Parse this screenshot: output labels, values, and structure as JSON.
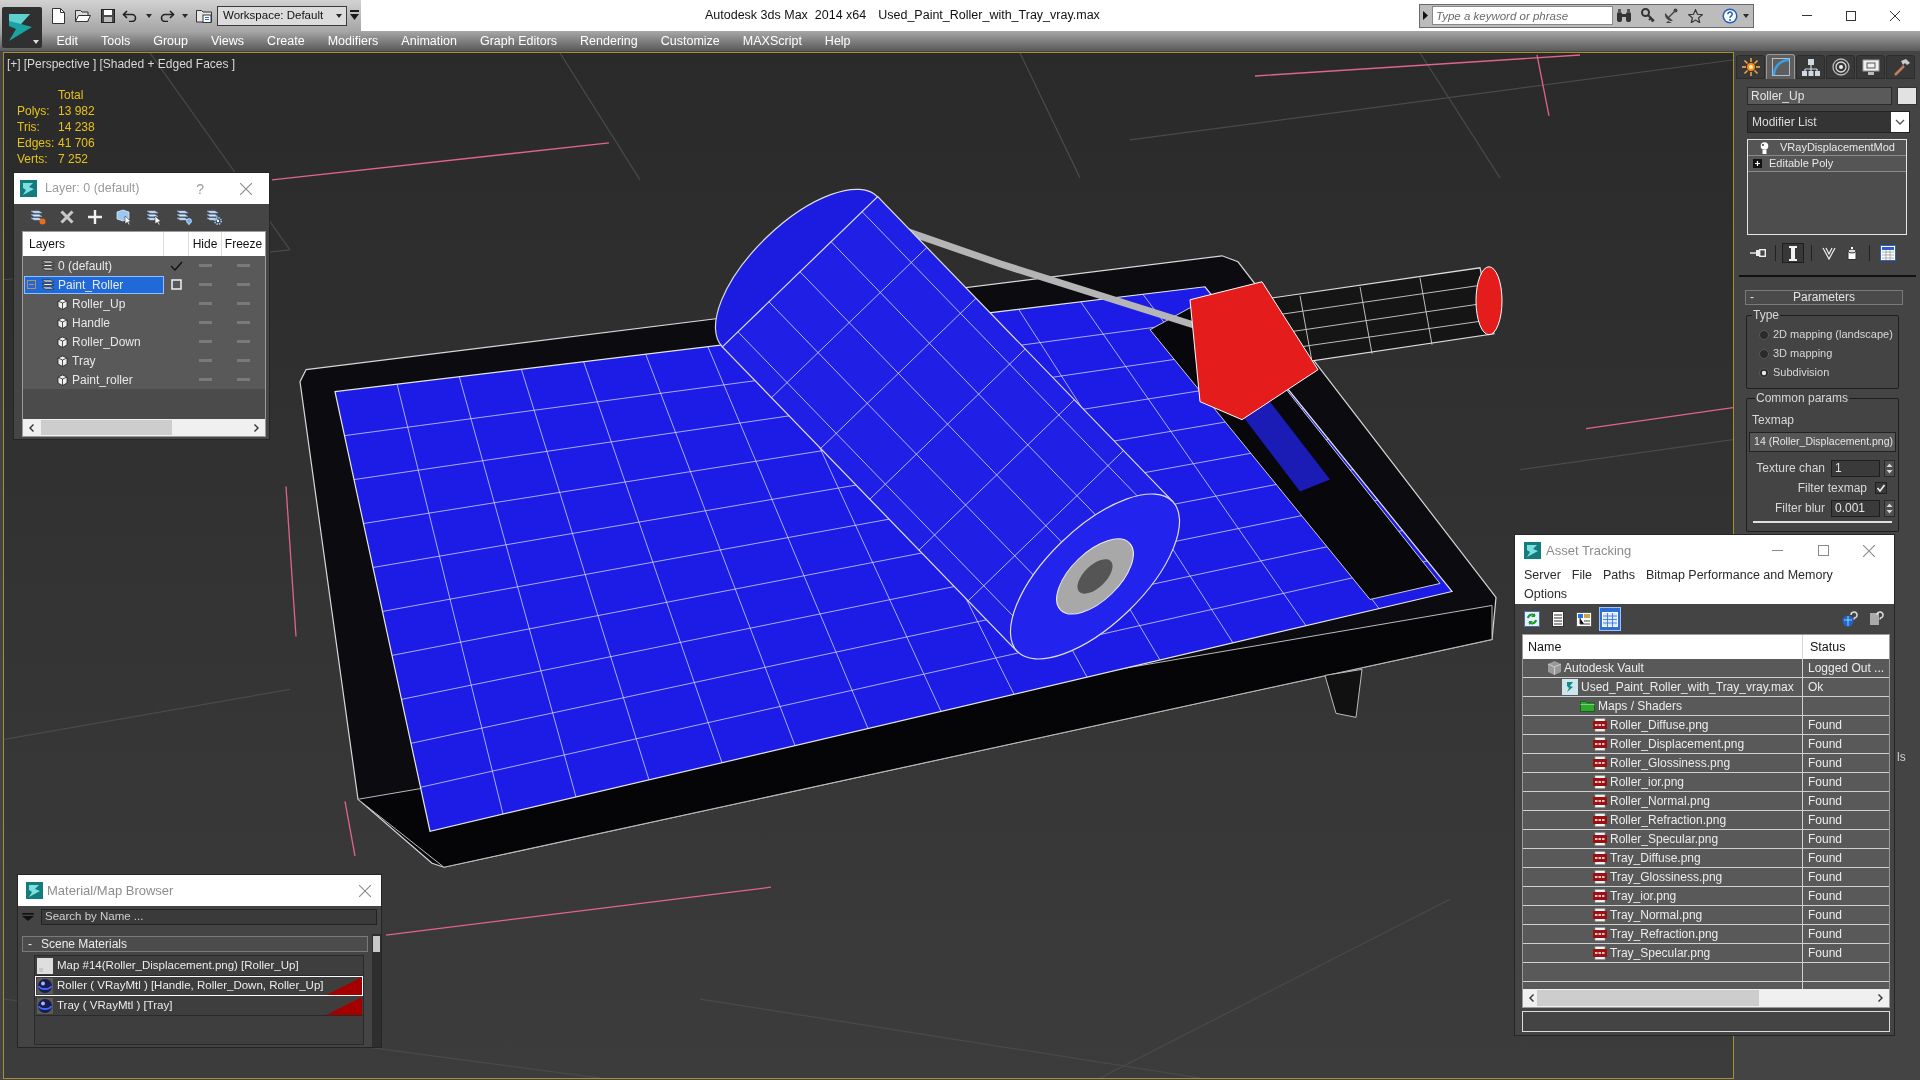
{
  "title_bar": {
    "workspace": "Workspace: Default",
    "app_title": "Autodesk 3ds Max  2014 x64",
    "file_name": "Used_Paint_Roller_with_Tray_vray.max",
    "search": {
      "placeholder": "Type a keyword or phrase"
    }
  },
  "menu_bar": [
    "Edit",
    "Tools",
    "Group",
    "Views",
    "Create",
    "Modifiers",
    "Animation",
    "Graph Editors",
    "Rendering",
    "Customize",
    "MAXScript",
    "Help"
  ],
  "viewport": {
    "labels": [
      "[+]",
      "[Perspective ]",
      "[Shaded + Edged Faces ]"
    ],
    "stats": {
      "heading": "Total",
      "rows": [
        {
          "label": "Polys:",
          "value": "13 982"
        },
        {
          "label": "Tris:",
          "value": "14 238"
        },
        {
          "label": "Edges:",
          "value": "41 706"
        },
        {
          "label": "Verts:",
          "value": "7 252"
        }
      ]
    }
  },
  "layer_dialog": {
    "title": "Layer: 0 (default)",
    "help_button": "?",
    "columns": [
      "Layers",
      "Hide",
      "Freeze"
    ],
    "layers": [
      {
        "name": "0 (default)",
        "selected": false,
        "current": true,
        "hidden": false,
        "frozen": false
      },
      {
        "name": "Paint_Roller",
        "selected": true,
        "current": false,
        "hidden": false,
        "frozen": false,
        "expanded": true,
        "children": [
          {
            "name": "Roller_Up",
            "selected": false,
            "hidden": false,
            "frozen": false
          },
          {
            "name": "Handle",
            "selected": false,
            "hidden": false,
            "frozen": false
          },
          {
            "name": "Roller_Down",
            "selected": false,
            "hidden": false,
            "frozen": false
          },
          {
            "name": "Tray",
            "selected": false,
            "hidden": false,
            "frozen": false
          },
          {
            "name": "Paint_roller",
            "selected": false,
            "hidden": false,
            "frozen": false
          }
        ]
      }
    ]
  },
  "command_panel": {
    "tabs": [
      {
        "selected": false
      },
      {
        "selected": true
      },
      {
        "selected": false
      },
      {
        "selected": false
      },
      {
        "selected": false
      },
      {
        "selected": false
      }
    ],
    "object_name": "Roller_Up",
    "modifier_list": "Modifier List",
    "modifier_stack": [
      {
        "kind": "modifier",
        "name": "VRayDisplacementMod",
        "selected": false
      },
      {
        "kind": "base_object",
        "name": "Editable Poly",
        "selected": false,
        "expanded": false
      }
    ],
    "stack_buttons": [
      {
        "pressed": false
      },
      {
        "pressed": true
      },
      {
        "pressed": false
      },
      {
        "pressed": false
      },
      {
        "pressed": false
      }
    ],
    "rollout": {
      "toggle": "-",
      "title": "Parameters",
      "type_group": {
        "label": "Type",
        "options": [
          {
            "label": "2D mapping (landscape)",
            "selected": false
          },
          {
            "label": "3D mapping",
            "selected": false
          },
          {
            "label": "Subdivision",
            "selected": true
          }
        ]
      },
      "common_group": {
        "label": "Common params",
        "texmap_label": "Texmap",
        "texmap_value": "14 (Roller_Displacement.png)",
        "fields": [
          {
            "kind": "spinner",
            "label": "Texture chan",
            "value": "1"
          },
          {
            "kind": "checkbox",
            "label": "Filter texmap",
            "checked": true
          },
          {
            "kind": "spinner",
            "label": "Filter blur",
            "value": "0.001"
          }
        ]
      }
    },
    "partial_label": "ls"
  },
  "asset_tracking": {
    "title": "Asset Tracking",
    "menu": [
      "Server",
      "File",
      "Paths",
      "Bitmap Performance and Memory",
      "Options"
    ],
    "toolbar": [
      {
        "selected": false
      },
      {
        "selected": false
      },
      {
        "selected": false
      },
      {
        "selected": true
      }
    ],
    "columns": [
      "Name",
      "Status"
    ],
    "assets": [
      {
        "kind": "vault",
        "name": "Autodesk Vault",
        "status": "Logged Out ...",
        "selected": false,
        "children": [
          {
            "kind": "scene",
            "name": "Used_Paint_Roller_with_Tray_vray.max",
            "status": "Ok",
            "selected": false,
            "children": [
              {
                "kind": "folder",
                "name": "Maps / Shaders",
                "selected": false,
                "children": [
                  {
                    "kind": "bitmap",
                    "name": "Roller_Diffuse.png",
                    "status": "Found",
                    "selected": false
                  },
                  {
                    "kind": "bitmap",
                    "name": "Roller_Displacement.png",
                    "status": "Found",
                    "selected": false
                  },
                  {
                    "kind": "bitmap",
                    "name": "Roller_Glossiness.png",
                    "status": "Found",
                    "selected": false
                  },
                  {
                    "kind": "bitmap",
                    "name": "Roller_ior.png",
                    "status": "Found",
                    "selected": false
                  },
                  {
                    "kind": "bitmap",
                    "name": "Roller_Normal.png",
                    "status": "Found",
                    "selected": false
                  },
                  {
                    "kind": "bitmap",
                    "name": "Roller_Refraction.png",
                    "status": "Found",
                    "selected": false
                  },
                  {
                    "kind": "bitmap",
                    "name": "Roller_Specular.png",
                    "status": "Found",
                    "selected": false
                  },
                  {
                    "kind": "bitmap",
                    "name": "Tray_Diffuse.png",
                    "status": "Found",
                    "selected": false
                  },
                  {
                    "kind": "bitmap",
                    "name": "Tray_Glossiness.png",
                    "status": "Found",
                    "selected": false
                  },
                  {
                    "kind": "bitmap",
                    "name": "Tray_ior.png",
                    "status": "Found",
                    "selected": false
                  },
                  {
                    "kind": "bitmap",
                    "name": "Tray_Normal.png",
                    "status": "Found",
                    "selected": false
                  },
                  {
                    "kind": "bitmap",
                    "name": "Tray_Refraction.png",
                    "status": "Found",
                    "selected": false
                  },
                  {
                    "kind": "bitmap",
                    "name": "Tray_Specular.png",
                    "status": "Found",
                    "selected": false
                  }
                ]
              }
            ]
          }
        ]
      }
    ]
  },
  "material_browser": {
    "title": "Material/Map Browser",
    "search": {
      "placeholder": "Search by Name ..."
    },
    "groups": [
      {
        "toggle": "-",
        "title": "Scene Materials",
        "items": [
          {
            "kind": "map",
            "name": "Map #14(Roller_Displacement.png) [Roller_Up]",
            "selected": false
          },
          {
            "kind": "material",
            "name": "Roller ( VRayMtl ) [Handle, Roller_Down, Roller_Up]",
            "selected": true
          },
          {
            "kind": "material",
            "name": "Tray ( VRayMtl ) [Tray]",
            "selected": false
          }
        ]
      }
    ]
  }
}
